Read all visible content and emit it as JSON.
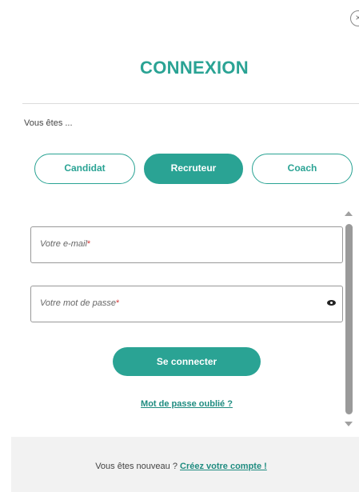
{
  "modal": {
    "close_symbol": "×",
    "title": "CONNEXION",
    "subtitle": "Vous êtes ..."
  },
  "roles": [
    {
      "label": "Candidat",
      "selected": false
    },
    {
      "label": "Recruteur",
      "selected": true
    },
    {
      "label": "Coach",
      "selected": false
    }
  ],
  "form": {
    "email_placeholder": "Votre e-mail",
    "password_placeholder": "Votre mot de passe",
    "required_mark": "*",
    "submit_label": "Se connecter",
    "forgot_label": "Mot de passe oublié ?"
  },
  "footer": {
    "text": "Vous êtes nouveau ?",
    "link": "Créez votre compte !"
  },
  "colors": {
    "accent": "#2aa394",
    "required": "#d63a3a",
    "footer_bg": "#f2f2f2"
  },
  "icons": {
    "close": "close-icon",
    "password_toggle": "eye-icon"
  }
}
